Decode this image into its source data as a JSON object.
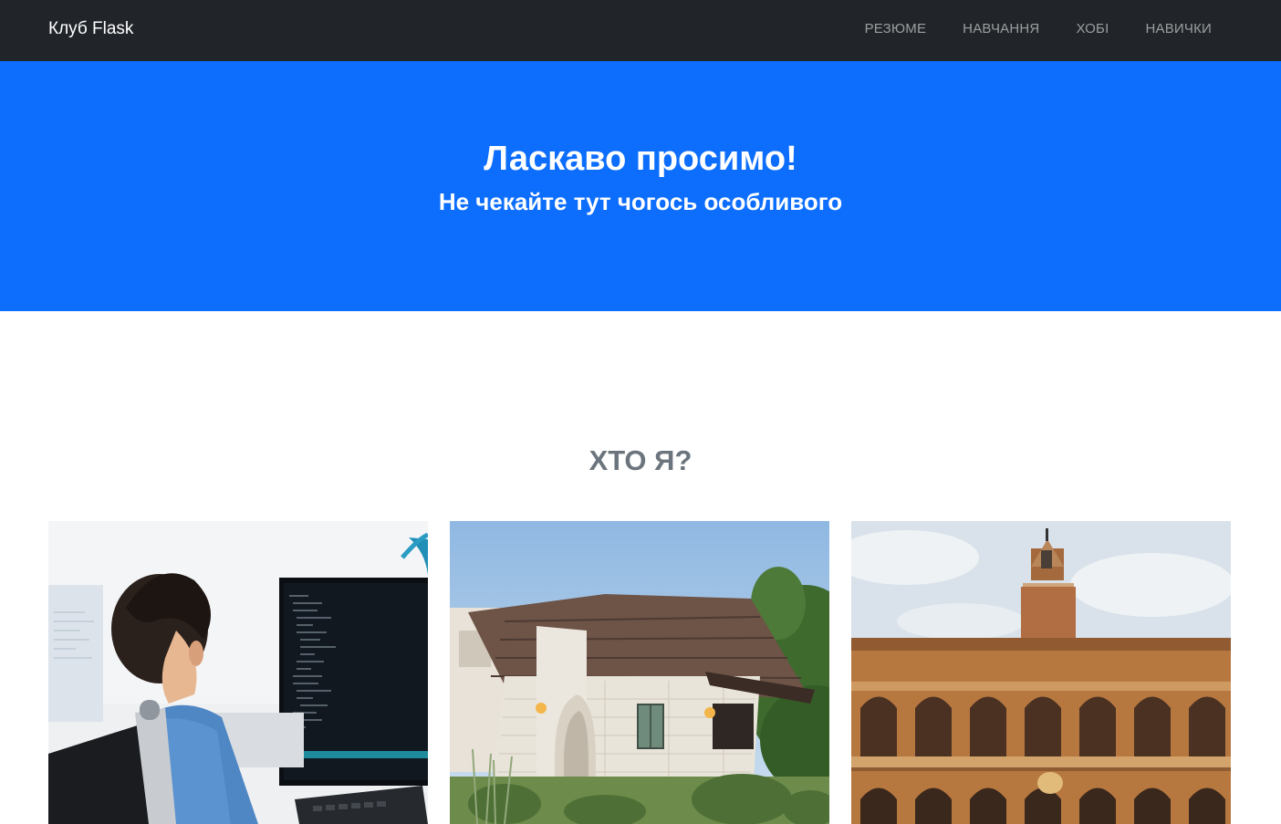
{
  "navbar": {
    "brand": "Клуб Flask",
    "links": [
      {
        "label": "РЕЗЮМЕ"
      },
      {
        "label": "НАВЧАННЯ"
      },
      {
        "label": "ХОБІ"
      },
      {
        "label": "НАВИЧКИ"
      }
    ]
  },
  "hero": {
    "title": "Ласкаво просимо!",
    "subtitle": "Не чекайте тут чогось особливого"
  },
  "about": {
    "title": "ХТО Я?"
  },
  "colors": {
    "navbar_bg": "#212529",
    "hero_bg": "#0d6efd",
    "section_title": "#6c757d"
  }
}
